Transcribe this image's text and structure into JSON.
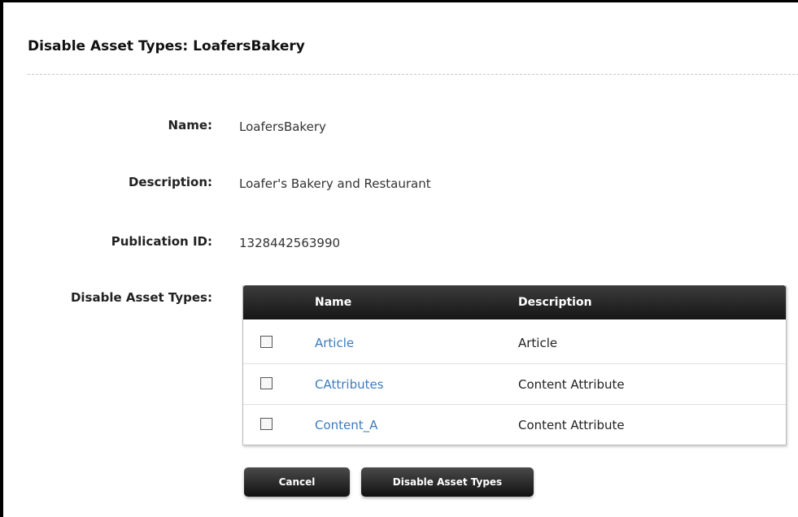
{
  "page": {
    "title": "Disable Asset Types: LoafersBakery"
  },
  "form": {
    "name_label": "Name:",
    "name_value": "LoafersBakery",
    "description_label": "Description:",
    "description_value": "Loafer's Bakery and Restaurant",
    "publication_id_label": "Publication ID:",
    "publication_id_value": "1328442563990",
    "asset_types_label": "Disable Asset Types:"
  },
  "table": {
    "columns": [
      "Name",
      "Description"
    ],
    "rows": [
      {
        "name": "Article",
        "description": "Article",
        "checked": false
      },
      {
        "name": "CAttributes",
        "description": "Content Attribute",
        "checked": false
      },
      {
        "name": "Content_A",
        "description": "Content Attribute",
        "checked": false
      }
    ]
  },
  "actions": {
    "cancel_label": "Cancel",
    "disable_label": "Disable Asset Types"
  },
  "colors": {
    "link": "#3b7bbf",
    "header_bg": "#1f1f1f",
    "button_bg": "#1a1a1a"
  }
}
